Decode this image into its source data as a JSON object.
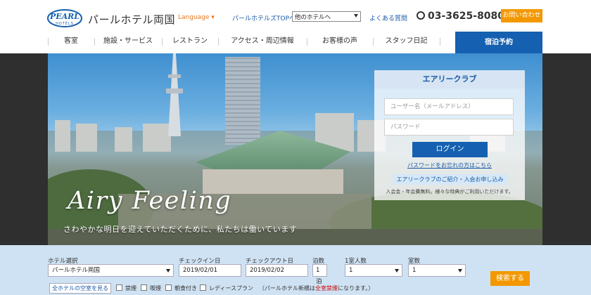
{
  "header": {
    "logo_mark": "PEARL HOTELS",
    "logo_text": "パールホテル両国",
    "language": "Language ▾",
    "top_link": "パールホテルズTOPへ",
    "hotel_select": "他のホテルへ",
    "faq": "よくある質問",
    "phone": "03-3625-8080",
    "contact": "お問い合わせ"
  },
  "nav": {
    "items": [
      "客室",
      "施設・サービス",
      "レストラン",
      "アクセス・周辺情報",
      "お客様の声",
      "スタッフ日記"
    ],
    "reserve": "宿泊予約"
  },
  "hero": {
    "tagline": "Airy Feeling",
    "subtag": "さわやかな明日を迎えていただくために、私たちは働いています"
  },
  "login": {
    "title": "エアリークラブ",
    "user_placeholder": "ユーザー名（メールアドレス）",
    "password_placeholder": "パスワード",
    "login_button": "ログイン",
    "forgot": "パスワードをお忘れの方はこちら",
    "club_button": "エアリークラブのご紹介・入会お申し込み",
    "club_note": "入会金・年会費無料。様々な特典がご利用いただけます。"
  },
  "booking": {
    "labels": {
      "hotel": "ホテル選択",
      "checkin": "チェックイン日",
      "checkout": "チェックアウト日",
      "nights": "泊数",
      "guests": "1室人数",
      "rooms": "室数"
    },
    "values": {
      "hotel": "パールホテル両国",
      "checkin": "2019/02/01",
      "checkout": "2019/02/02",
      "nights": "1泊",
      "guests": "1",
      "rooms": "1"
    },
    "search": "検索する",
    "vacancy": "全ホテルの空室を見る",
    "options": [
      "禁煙",
      "喫煙",
      "朝食付き",
      "レディースプラン"
    ],
    "ladies_note_pre": "（パールホテル新橋は",
    "ladies_note_em": "全室禁煙",
    "ladies_note_post": "になります。）"
  }
}
